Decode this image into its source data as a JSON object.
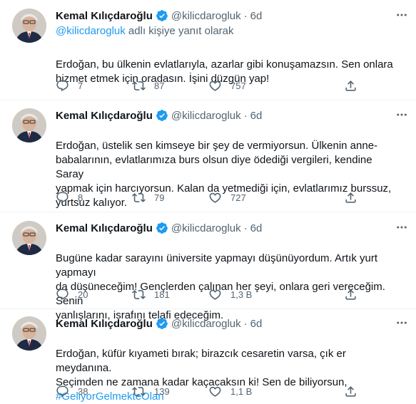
{
  "colors": {
    "accent": "#1d9bf0",
    "text": "#0f1419",
    "muted": "#536471",
    "divider": "#eff3f4"
  },
  "icons": [
    "verified-badge-icon",
    "more-icon",
    "reply-icon",
    "retweet-icon",
    "like-icon",
    "share-icon"
  ],
  "tweets": [
    {
      "name": "Kemal Kılıçdaroğlu",
      "handle": "@kilicdarogluk",
      "separator": "·",
      "time": "6d",
      "reply_mention": "@kilicdarogluk",
      "reply_suffix": " adlı kişiye yanıt olarak",
      "text": "Erdoğan, bu ülkenin evlatlarıyla, azarlar gibi konuşamazsın. Sen onlara\nhizmet etmek için oradasın. İşini düzgün yap!",
      "replies": "7",
      "retweets": "87",
      "likes": "757"
    },
    {
      "name": "Kemal Kılıçdaroğlu",
      "handle": "@kilicdarogluk",
      "separator": "·",
      "time": "6d",
      "text": "Erdoğan, üstelik sen kimseye bir şey de vermiyorsun. Ülkenin anne-\nbabalarının, evlatlarımıza burs olsun diye ödediği vergileri, kendine Saray\nyapmak için harcıyorsun. Kalan da yetmediği için, evlatlarımız burssuz,\nyurtsuz kalıyor.",
      "replies": "8",
      "retweets": "79",
      "likes": "727"
    },
    {
      "name": "Kemal Kılıçdaroğlu",
      "handle": "@kilicdarogluk",
      "separator": "·",
      "time": "6d",
      "text": "Bugüne kadar sarayını üniversite yapmayı düşünüyordum. Artık yurt yapmayı\nda düşüneceğim! Gençlerden çalınan her şeyi, onlara geri vereceğim. Senin\nyanlışlarını, israfını telafi edeceğim.",
      "replies": "20",
      "retweets": "181",
      "likes": "1,3 B"
    },
    {
      "name": "Kemal Kılıçdaroğlu",
      "handle": "@kilicdarogluk",
      "separator": "·",
      "time": "6d",
      "text": "Erdoğan, küfür kıyameti bırak; birazcık cesaretin varsa, çık er meydanına.\nSeçimden ne zamana kadar kaçacaksın ki! Sen de biliyorsun,",
      "hashtag": "#GeliyorGelmekteOlan",
      "replies": "38",
      "retweets": "139",
      "likes": "1,1 B"
    }
  ]
}
